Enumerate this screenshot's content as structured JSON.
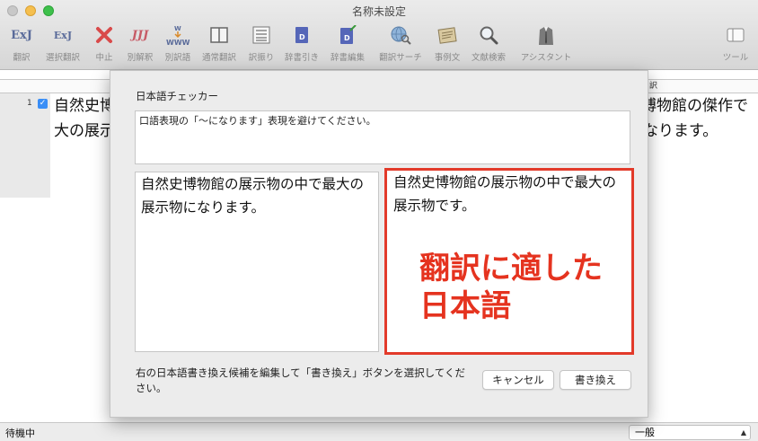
{
  "window": {
    "title": "名称未設定"
  },
  "toolbar": {
    "items": [
      {
        "label": "翻訳",
        "icon_text": "ExJ"
      },
      {
        "label": "選択翻訳",
        "icon_text": "ExJ"
      },
      {
        "label": "中止"
      },
      {
        "label": "別解釈",
        "icon_text": "JJJ"
      },
      {
        "label": "別訳語"
      },
      {
        "label": "通常翻訳"
      },
      {
        "label": "訳振り"
      },
      {
        "label": "辞書引き"
      },
      {
        "label": "辞書編集"
      },
      {
        "label": "翻訳サーチ"
      },
      {
        "label": "事例文"
      },
      {
        "label": "文献検索"
      },
      {
        "label": "アシスタント"
      },
      {
        "label": "ツール"
      }
    ]
  },
  "table": {
    "right_header": "訳",
    "row": {
      "number": "1",
      "source_l1": "自然史博",
      "source_l2": "大の展示",
      "target_l1": "博物館の傑作で",
      "target_l2": "なります。"
    }
  },
  "dialog": {
    "title": "日本語チェッカー",
    "message": "口語表現の「〜になります」表現を避けてください。",
    "original_text": "自然史博物館の展示物の中で最大の展示物になります。",
    "suggested_text": "自然史博物館の展示物の中で最大の展示物です。",
    "annotation_l1": "翻訳に適した",
    "annotation_l2": "日本語",
    "note": "右の日本語書き換え候補を編集して「書き換え」ボタンを選択してください。",
    "cancel_label": "キャンセル",
    "replace_label": "書き換え"
  },
  "status": {
    "text": "待機中",
    "mode": "一般"
  },
  "colors": {
    "highlight_red": "#e23a2a",
    "check_blue": "#3a8ef6"
  }
}
